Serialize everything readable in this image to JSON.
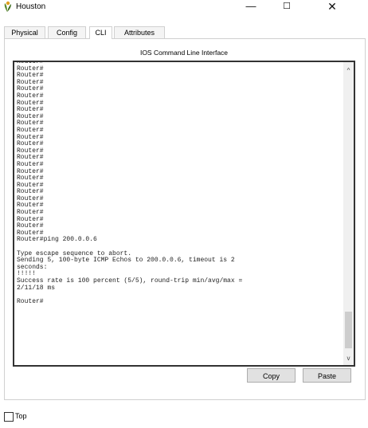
{
  "window": {
    "title": "Houston",
    "minimize_glyph": "—",
    "maximize_glyph": "☐",
    "close_glyph": "✕"
  },
  "tabs": [
    {
      "label": "Physical"
    },
    {
      "label": "Config"
    },
    {
      "label": "CLI"
    },
    {
      "label": "Attributes"
    }
  ],
  "active_tab": "CLI",
  "cli": {
    "header": "IOS Command Line Interface",
    "lines": [
      "Router#",
      "Router#",
      "Router#",
      "Router#",
      "Router#",
      "Router#",
      "Router#",
      "Router#",
      "Router#",
      "Router#",
      "Router#",
      "Router#",
      "Router#",
      "Router#",
      "Router#",
      "Router#",
      "Router#",
      "Router#",
      "Router#",
      "Router#",
      "Router#",
      "Router#",
      "Router#",
      "Router#",
      "Router#",
      "Router#",
      "Router#ping 200.0.0.6",
      "",
      "Type escape sequence to abort.",
      "Sending 5, 100-byte ICMP Echos to 200.0.0.6, timeout is 2",
      "seconds:",
      "!!!!!",
      "Success rate is 100 percent (5/5), round-trip min/avg/max =",
      "2/11/18 ms",
      "",
      "Router#"
    ],
    "scroll_up_glyph": "^",
    "scroll_down_glyph": "v"
  },
  "buttons": {
    "copy_label": "Copy",
    "paste_label": "Paste"
  },
  "footer": {
    "top_label": "Top",
    "top_checked": false
  },
  "icons": {
    "app": "packet-tracer-router-icon"
  }
}
